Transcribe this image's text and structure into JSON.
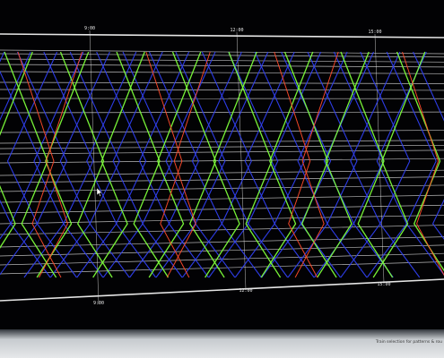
{
  "colors": {
    "background": "#020204",
    "frame_line": "#e6e6e6",
    "track_line": "#d9d9d9",
    "series_blue": "#2f3ff0",
    "series_green": "#7dff3a",
    "series_red": "#ff4a2a",
    "status_text": "#3a3a3a"
  },
  "axis": {
    "top_ticks": [
      "9:00",
      "12:00",
      "15:00"
    ],
    "bottom_ticks": [
      "9:00",
      "12:00",
      "15:00"
    ]
  },
  "status_bar": {
    "text": "Train selection for patterns & rou"
  },
  "cursor_icon": "arrow-cursor-icon"
}
